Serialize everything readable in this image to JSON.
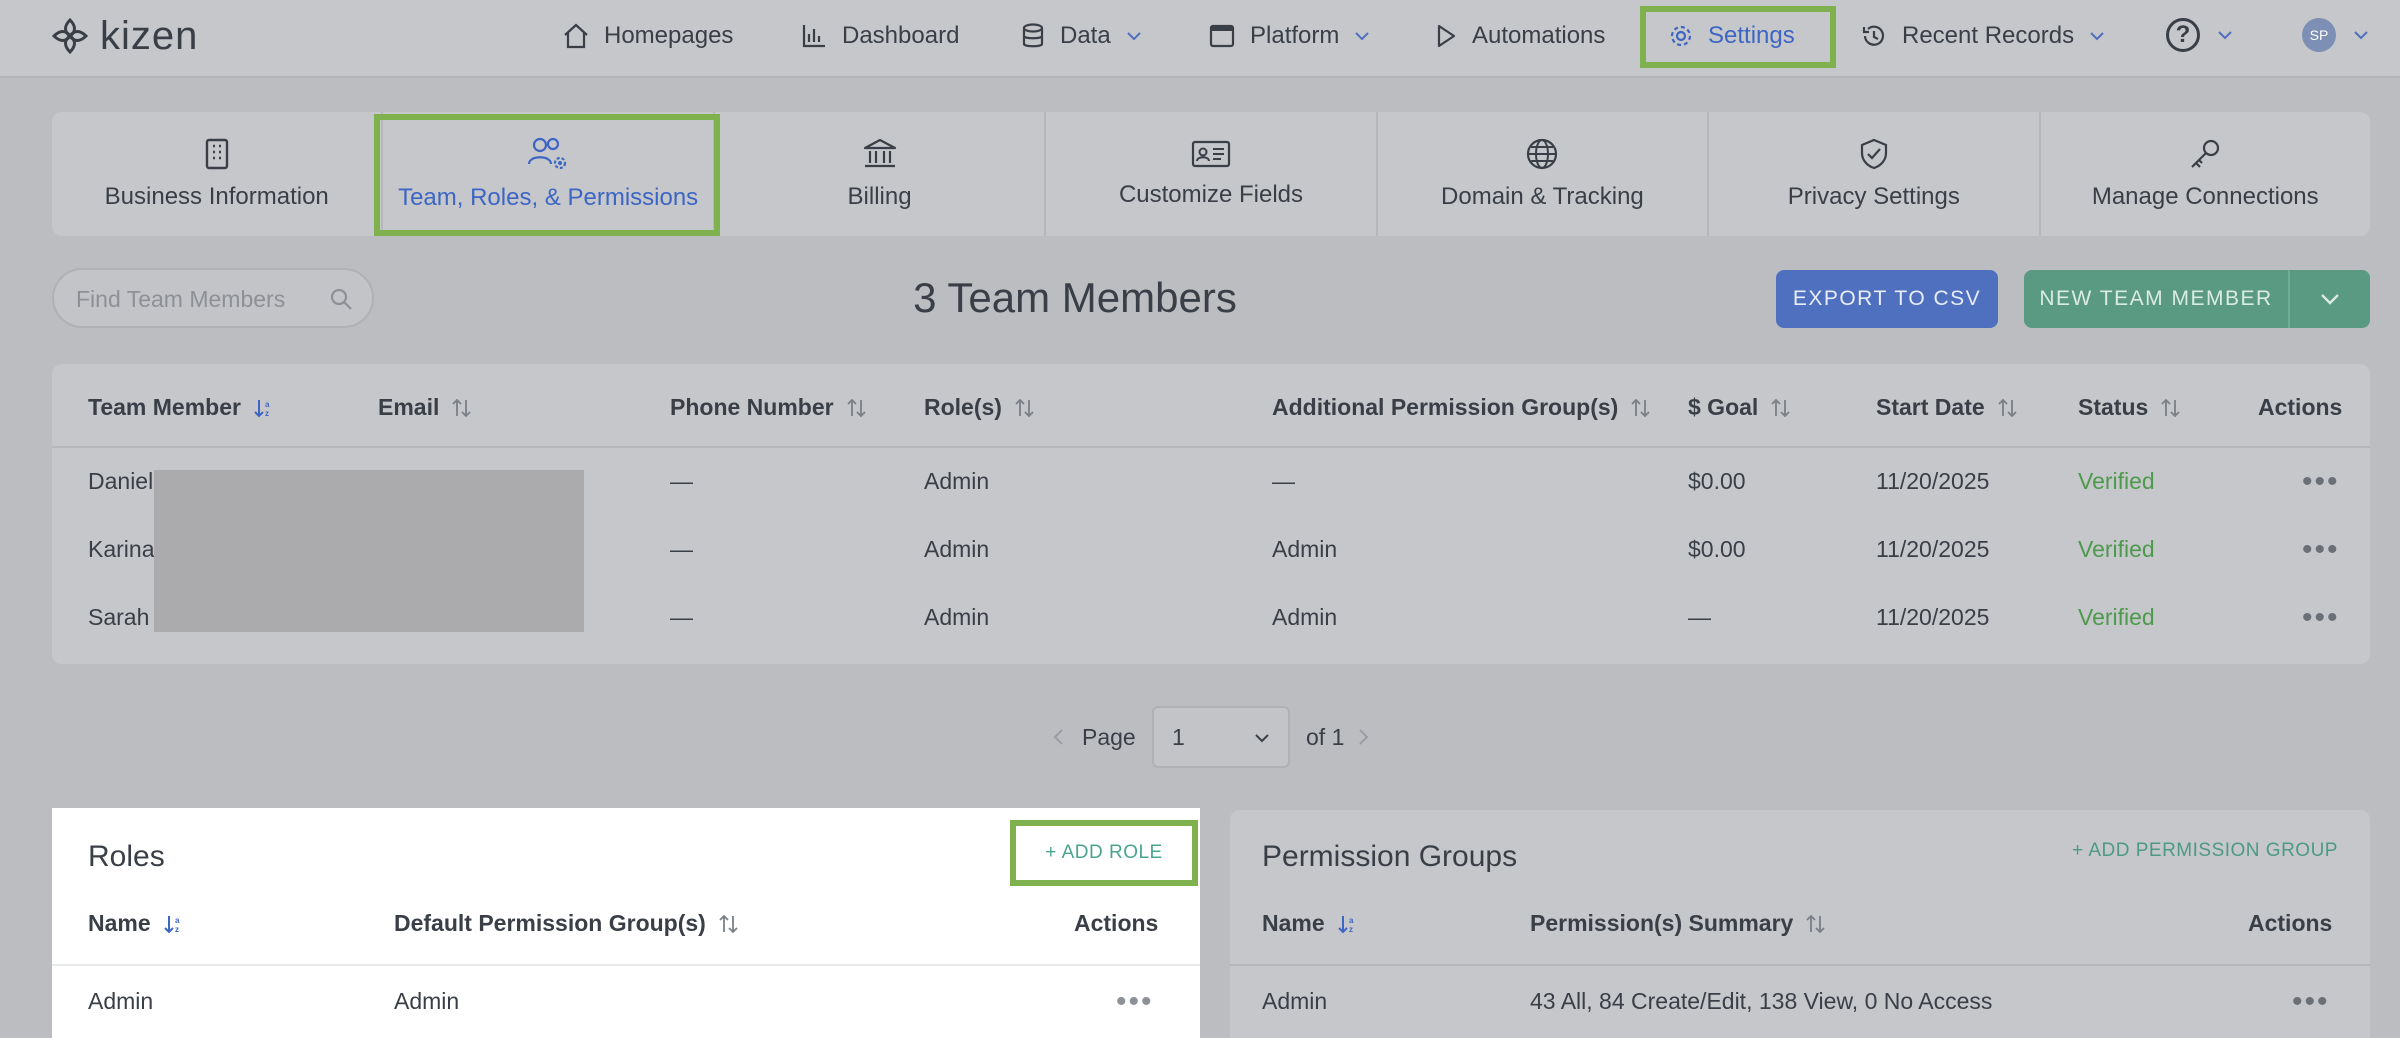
{
  "app": {
    "brand": "kizen"
  },
  "nav": {
    "homepages": "Homepages",
    "dashboard": "Dashboard",
    "data": "Data",
    "platform": "Platform",
    "automations": "Automations",
    "settings": "Settings",
    "recent_records": "Recent Records",
    "help": "?",
    "avatar_initials": "SP"
  },
  "tabs": [
    {
      "label": "Business Information"
    },
    {
      "label": "Team, Roles, & Permissions"
    },
    {
      "label": "Billing"
    },
    {
      "label": "Customize Fields"
    },
    {
      "label": "Domain & Tracking"
    },
    {
      "label": "Privacy Settings"
    },
    {
      "label": "Manage Connections"
    }
  ],
  "toolbar": {
    "search_placeholder": "Find Team Members",
    "member_count": "3 Team Members",
    "export_label": "EXPORT TO CSV",
    "new_member_label": "NEW TEAM MEMBER"
  },
  "team_table": {
    "columns": [
      "Team Member",
      "Email",
      "Phone Number",
      "Role(s)",
      "Additional Permission Group(s)",
      "$ Goal",
      "Start Date",
      "Status",
      "Actions"
    ],
    "rows": [
      {
        "name": "Daniel",
        "email": "",
        "phone": "—",
        "role": "Admin",
        "groups": "—",
        "goal": "$0.00",
        "start": "11/20/2025",
        "status": "Verified"
      },
      {
        "name": "Karina",
        "email": "",
        "phone": "—",
        "role": "Admin",
        "groups": "Admin",
        "goal": "$0.00",
        "start": "11/20/2025",
        "status": "Verified"
      },
      {
        "name": "Sarah",
        "email": "",
        "phone": "—",
        "role": "Admin",
        "groups": "Admin",
        "goal": "—",
        "start": "11/20/2025",
        "status": "Verified"
      }
    ]
  },
  "pagination": {
    "page_label": "Page",
    "current": "1",
    "of_label": "of 1"
  },
  "roles": {
    "title": "Roles",
    "add_label": "+ ADD ROLE",
    "columns": [
      "Name",
      "Default Permission Group(s)",
      "Actions"
    ],
    "rows": [
      {
        "name": "Admin",
        "default_group": "Admin"
      }
    ]
  },
  "permission_groups": {
    "title": "Permission Groups",
    "add_label": "+ ADD PERMISSION GROUP",
    "columns": [
      "Name",
      "Permission(s) Summary",
      "Actions"
    ],
    "rows": [
      {
        "name": "Admin",
        "summary": "43 All, 84 Create/Edit, 138 View, 0 No Access"
      }
    ]
  },
  "colors": {
    "accent_blue": "#3d66c4",
    "highlight_green": "#7fb24e",
    "verified_green": "#4d9a4d",
    "teal": "#4aa58f"
  },
  "icons": [
    "kizen-logo-icon",
    "home-icon",
    "dashboard-icon",
    "database-icon",
    "window-icon",
    "play-icon",
    "gear-icon",
    "history-icon",
    "help-icon",
    "chevron-down-icon",
    "building-icon",
    "team-gear-icon",
    "bank-icon",
    "id-card-icon",
    "globe-icon",
    "shield-check-icon",
    "key-icon",
    "search-icon",
    "sort-icon",
    "more-dots-icon",
    "chevron-left-icon",
    "chevron-right-icon"
  ]
}
